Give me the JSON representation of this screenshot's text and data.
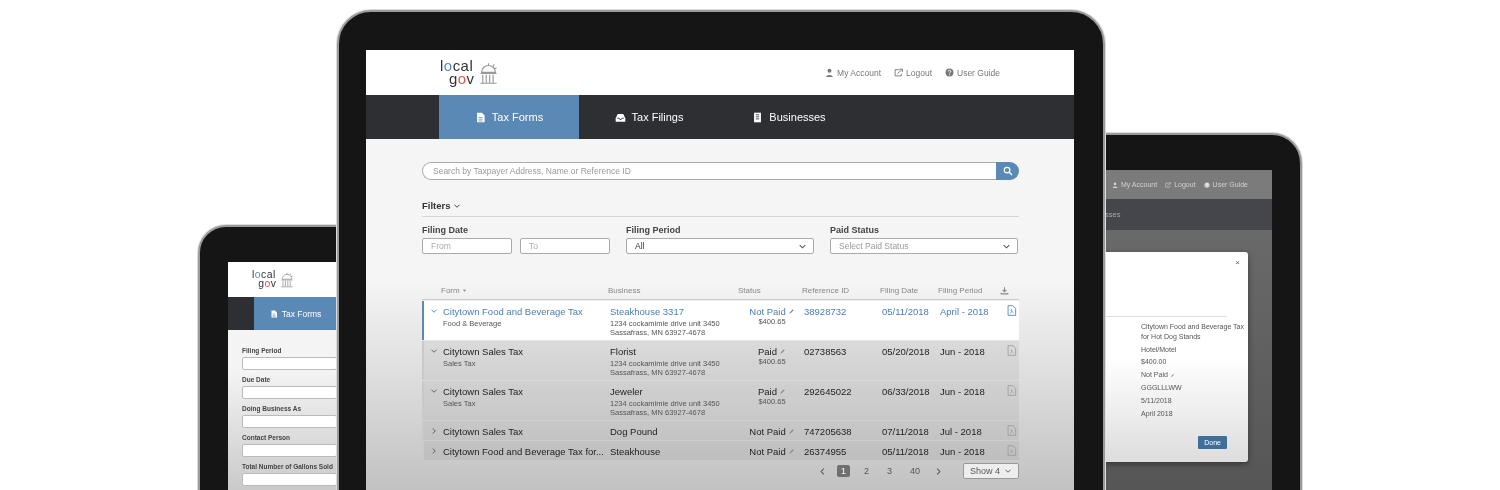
{
  "main_screen": {
    "logo": {
      "top": "local",
      "bottom": "gov"
    },
    "header_links": [
      {
        "label": "My Account",
        "kind": "user"
      },
      {
        "label": "Logout",
        "kind": "exit"
      },
      {
        "label": "User Guide",
        "kind": "help"
      }
    ],
    "tabs": [
      {
        "label": "Tax Forms",
        "kind": "document",
        "selected": true
      },
      {
        "label": "Tax Filings",
        "kind": "tray",
        "selected": false
      },
      {
        "label": "Businesses",
        "kind": "building",
        "selected": false
      }
    ],
    "search": {
      "placeholder": "Search by Taxpayer Address, Name or Reference ID"
    },
    "filters_toggle": "Filters",
    "filters": [
      {
        "label": "Filing Date",
        "kind": "range",
        "fields": [
          {
            "placeholder": "From"
          },
          {
            "placeholder": "To"
          }
        ]
      },
      {
        "label": "Filing Period",
        "kind": "select",
        "value": "All"
      },
      {
        "label": "Paid Status",
        "kind": "select",
        "placeholder": "Select Paid Status"
      }
    ],
    "table": {
      "columns": [
        "Form",
        "Business",
        "Status",
        "Reference ID",
        "Filing Date",
        "Filing Period"
      ],
      "rows": [
        {
          "selected": true,
          "expanded": true,
          "form": "Citytown Food and Beverage Tax",
          "category": "Food & Beverage",
          "business": "Steakhouse 3317",
          "address": [
            "1234 cockamimie drive unit 3450",
            "Sassafrass, MN 63927-4678"
          ],
          "status": "Not Paid",
          "amount": "$400.65",
          "reference_id": "38928732",
          "filing_date": "05/11/2018",
          "filing_period": "April - 2018"
        },
        {
          "selected": false,
          "expanded": true,
          "form": "Citytown Sales Tax",
          "category": "Sales Tax",
          "business": "Florist",
          "address": [
            "1234 cockamimie drive unit 3450",
            "Sassafrass, MN 63927-4678"
          ],
          "status": "Paid",
          "amount": "$400.65",
          "reference_id": "02738563",
          "filing_date": "05/20/2018",
          "filing_period": "Jun - 2018"
        },
        {
          "selected": false,
          "expanded": true,
          "form": "Citytown Sales Tax",
          "category": "Sales Tax",
          "business": "Jeweler",
          "address": [
            "1234 cockamimie drive unit 3450",
            "Sassafrass, MN 63927-4678"
          ],
          "status": "Paid",
          "amount": "$400.65",
          "reference_id": "292645022",
          "filing_date": "06/33/2018",
          "filing_period": "Jun - 2018"
        },
        {
          "selected": false,
          "expanded": false,
          "form": "Citytown Sales Tax",
          "business": "Dog Pound",
          "status": "Not Paid",
          "reference_id": "747205638",
          "filing_date": "07/11/2018",
          "filing_period": "Jul - 2018"
        },
        {
          "selected": false,
          "expanded": false,
          "form": "Citytown Food and Beverage Tax for...",
          "business": "Steakhouse",
          "status": "Not Paid",
          "reference_id": "26374955",
          "filing_date": "05/11/2018",
          "filing_period": "Jun - 2018"
        }
      ]
    },
    "pagination": {
      "pages": [
        {
          "label": "1",
          "selected": true
        },
        {
          "label": "2",
          "selected": false
        },
        {
          "label": "3",
          "selected": false
        },
        {
          "label": "40",
          "selected": false
        }
      ],
      "page_size": "Show 4"
    }
  },
  "left_screen": {
    "logo": {
      "top": "local",
      "bottom": "gov"
    },
    "tabs": [
      {
        "label": "Tax Forms",
        "kind": "document",
        "selected": true
      }
    ],
    "fields": [
      {
        "label": "Filing Period"
      },
      {
        "label": "Due Date"
      },
      {
        "label": "Doing Business As"
      },
      {
        "label": "Contact Person"
      },
      {
        "label": "Total Number of Gallons Sold"
      }
    ]
  },
  "right_screen": {
    "header_links": [
      {
        "label": "My Account",
        "kind": "user"
      },
      {
        "label": "Logout",
        "kind": "exit"
      },
      {
        "label": "User Guide",
        "kind": "help"
      }
    ],
    "nav_text": "sses",
    "modal": {
      "close": "×",
      "values": [
        {
          "text": "Citytown Food and Beverage Tax for Hot Dog Stands",
          "kind": "plain"
        },
        {
          "text": "Hotel/Motel",
          "kind": "plain"
        },
        {
          "text": "$400.00",
          "kind": "plain"
        },
        {
          "text": "Not Paid",
          "kind": "editable"
        },
        {
          "text": "GGGLLLWW",
          "kind": "plain"
        },
        {
          "text": "5/11/2018",
          "kind": "plain"
        },
        {
          "text": "April 2018",
          "kind": "plain"
        }
      ],
      "button": "Done"
    }
  }
}
